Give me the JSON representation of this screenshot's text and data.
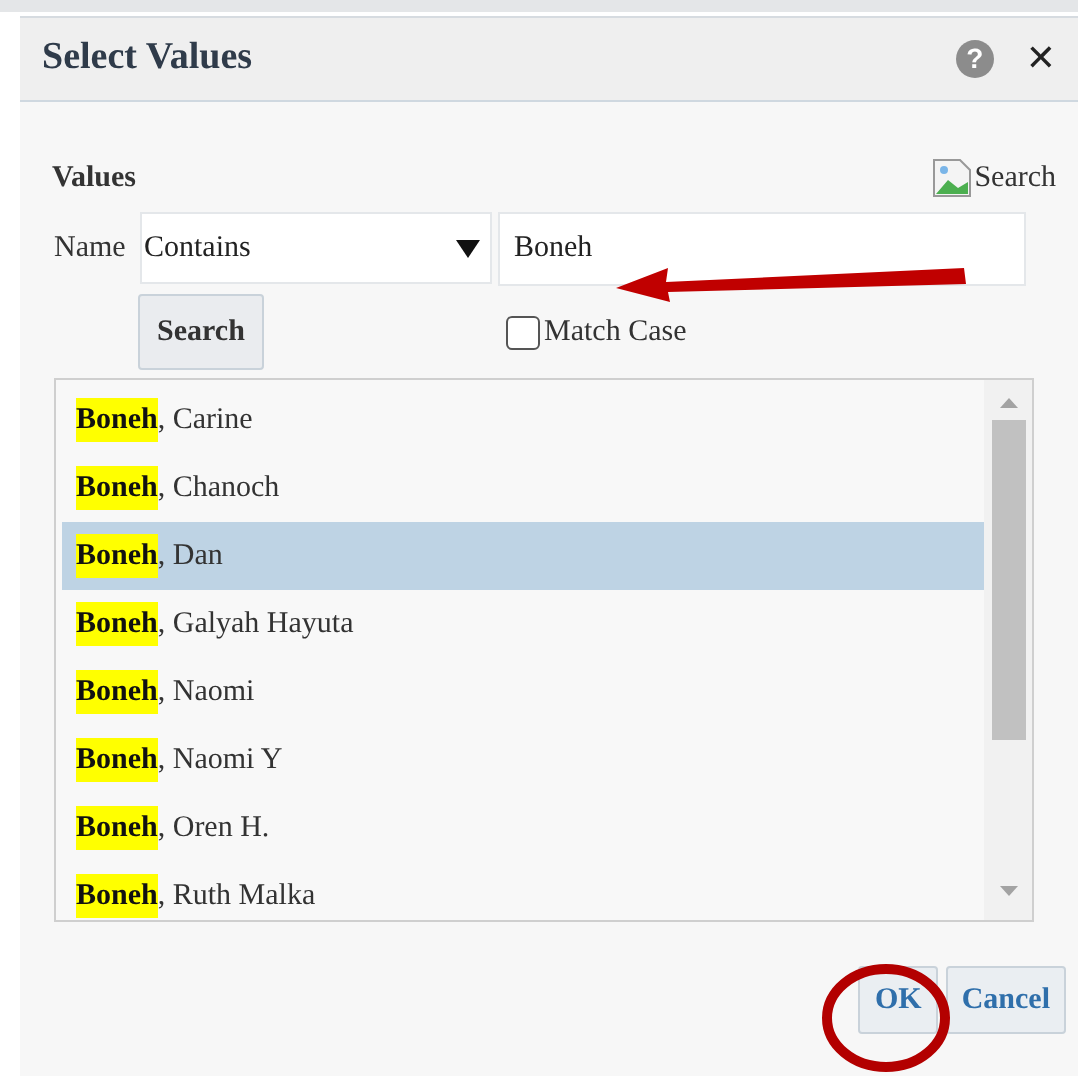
{
  "dialog": {
    "title": "Select Values",
    "help": "?",
    "close": "✕"
  },
  "section_title": "Values",
  "search_link": "Search",
  "filter": {
    "label": "Name",
    "operator": "Contains",
    "value": "Boneh"
  },
  "search_button": "Search",
  "match_case": {
    "label": "Match Case",
    "checked": false
  },
  "results": [
    {
      "text": "**Boneh**, Carine",
      "selected": false
    },
    {
      "text": "**Boneh**, Chanoch",
      "selected": false
    },
    {
      "text": "**Boneh**, Dan",
      "selected": true
    },
    {
      "text": "**Boneh**, Galyah Hayuta",
      "selected": false
    },
    {
      "text": "**Boneh**, Naomi",
      "selected": false
    },
    {
      "text": "**Boneh**, Naomi Y",
      "selected": false
    },
    {
      "text": "**Boneh**, Oren H.",
      "selected": false
    },
    {
      "text": "**Boneh**, Ruth Malka",
      "selected": false
    }
  ],
  "buttons": [
    "OK",
    "Cancel"
  ]
}
